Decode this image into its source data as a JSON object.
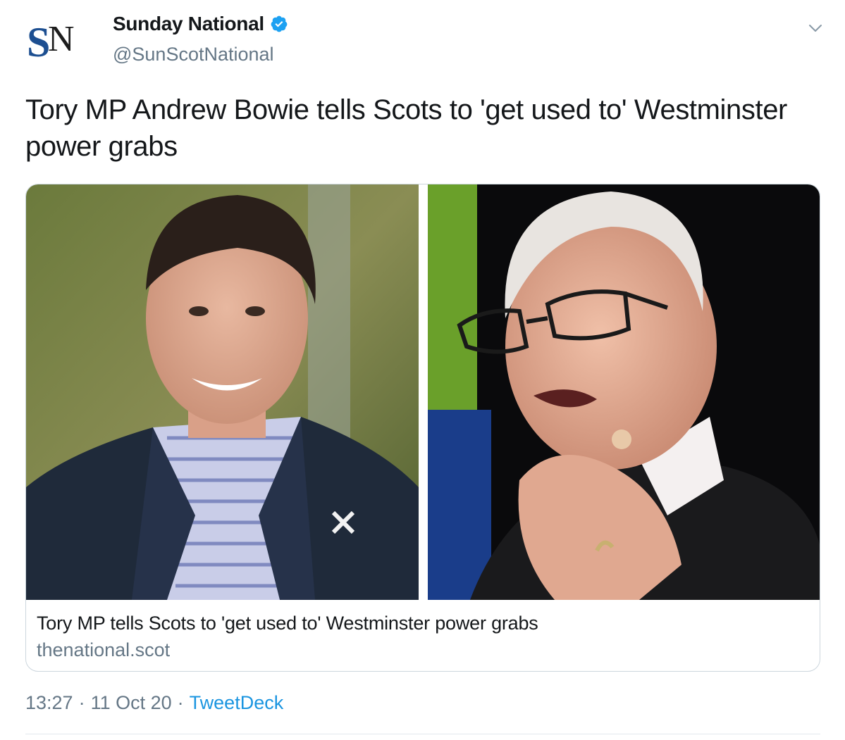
{
  "author": {
    "display_name": "Sunday National",
    "handle": "@SunScotNational",
    "verified": true,
    "avatar_text": "SN",
    "avatar_color": "#1d4f91"
  },
  "tweet": {
    "text": "Tory MP Andrew Bowie tells Scots to 'get used to' Westminster power grabs"
  },
  "card": {
    "title": "Tory MP tells Scots to 'get used to' Westminster power grabs",
    "domain": "thenational.scot",
    "images": [
      "photo-young-man-smiling",
      "photo-older-man-speaking"
    ]
  },
  "meta": {
    "time": "13:27",
    "separator": "·",
    "date": "11 Oct 20",
    "source": "TweetDeck"
  },
  "icons": {
    "verified": "verified-badge-icon",
    "menu": "chevron-down-icon"
  },
  "colors": {
    "text": "#14171a",
    "secondary": "#657786",
    "link": "#1b95e0",
    "verified": "#1da1f2",
    "border": "#ccd6dd"
  }
}
